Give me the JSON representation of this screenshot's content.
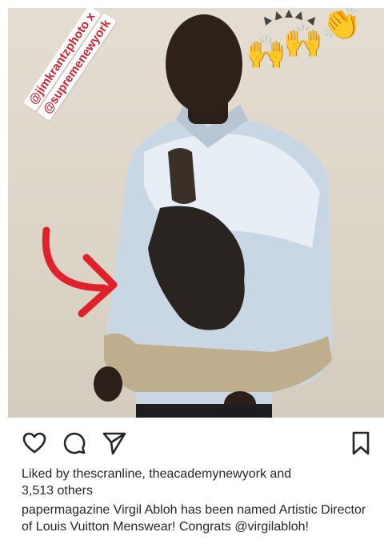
{
  "post": {
    "tags": [
      "@jimkrantzphoto x",
      "@supremenewyork"
    ],
    "emoji": {
      "sparkles_icon": "sparkles-icon",
      "clap_icon": "raised-hands-icon",
      "clap_char": "🙌",
      "clap2_char": "👏"
    },
    "colors": {
      "tag_red": "#d41f2f",
      "arrow_red": "#e0202a",
      "background": "#e4ddd1"
    }
  },
  "actions": {
    "like_icon": "heart-icon",
    "comment_icon": "comment-icon",
    "share_icon": "send-icon",
    "save_icon": "bookmark-icon"
  },
  "likes": {
    "prefix": "Liked by ",
    "user1": "thescranline",
    "sep": ", ",
    "user2": "theacademynewyork",
    "and": " and",
    "others": "3,513 others"
  },
  "caption": {
    "username": "papermagazine",
    "text": " Virgil Abloh has been named Artistic Director of Louis Vuitton Menswear! Congrats ",
    "mention": "@virgilabloh",
    "end": "!"
  }
}
